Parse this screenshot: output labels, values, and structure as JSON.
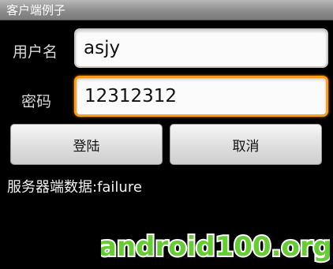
{
  "window": {
    "title": "客户端例子"
  },
  "form": {
    "username_label": "用户名",
    "username_value": "asjy",
    "password_label": "密码",
    "password_value": "12312312"
  },
  "buttons": {
    "login_label": "登陆",
    "cancel_label": "取消"
  },
  "result": {
    "text": "服务器端数据:failure"
  },
  "watermark": {
    "text": "android100.org"
  },
  "colors": {
    "focus": "#ff9c1a",
    "watermark": "#66cc33",
    "background": "#000000"
  }
}
